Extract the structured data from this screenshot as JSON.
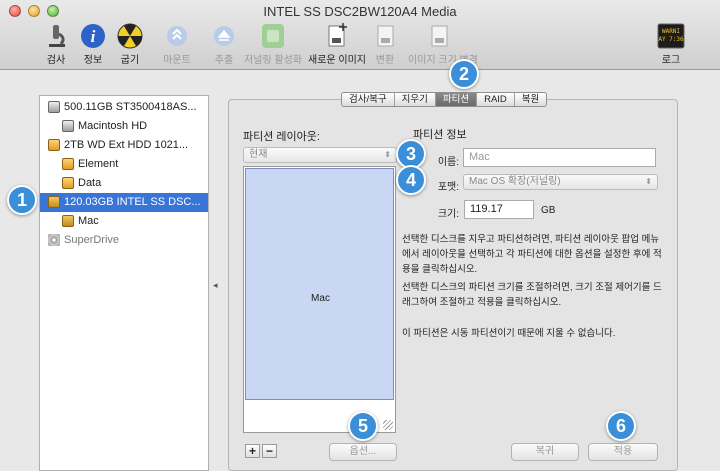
{
  "window": {
    "title": "INTEL SS DSC2BW120A4 Media"
  },
  "toolbar": {
    "verify": "검사",
    "info": "정보",
    "burn": "굽기",
    "mount": "마운트",
    "eject": "추출",
    "journaling": "저널링 활성화",
    "new_image": "새로운 이미지",
    "convert": "변환",
    "resize_image": "이미지 크기 변경",
    "log": "로그",
    "log_icon_text_1": "WARNI",
    "log_icon_text_2": "AY 7:36"
  },
  "sidebar": {
    "items": [
      {
        "label": "500.11GB ST3500418AS..."
      },
      {
        "label": "Macintosh HD"
      },
      {
        "label": "2TB WD Ext HDD 1021..."
      },
      {
        "label": "Element"
      },
      {
        "label": "Data"
      },
      {
        "label": "120.03GB INTEL SS DSC..."
      },
      {
        "label": "Mac"
      },
      {
        "label": "SuperDrive"
      }
    ]
  },
  "tabs": [
    "검사/복구",
    "지우기",
    "파티션",
    "RAID",
    "복원"
  ],
  "layout_section": {
    "heading": "파티션 레이아웃:",
    "popup_value": "현재",
    "partition_name": "Mac",
    "plus": "+",
    "minus": "−",
    "options_button": "옵션..."
  },
  "info_section": {
    "heading": "파티션 정보",
    "name_label": "이름:",
    "name_value": "Mac",
    "format_label": "포맷:",
    "format_value": "Mac OS 확장(저널링)",
    "size_label": "크기:",
    "size_value": "119.17",
    "size_unit": "GB",
    "para1": "선택한 디스크를 지우고 파티션하려면, 파티션 레이아웃 팝업 메뉴에서 레이아웃을 선택하고 각 파티션에 대한 옵션을 설정한 후에 적용을 클릭하십시오.",
    "para2": "선택한 디스크의 파티션 크기를 조절하려면, 크기 조절 제어기를 드래그하여 조절하고 적용을 클릭하십시오.",
    "para3": "이 파티션은 시동 파티션이기 때문에 지울 수 없습니다.",
    "revert_button": "복귀",
    "apply_button": "적용"
  },
  "badges": [
    "1",
    "2",
    "3",
    "4",
    "5",
    "6"
  ],
  "colors": {
    "selection": "#3875d7",
    "badge": "#3a8fd8",
    "partition_fill": "#c9d7f5"
  }
}
